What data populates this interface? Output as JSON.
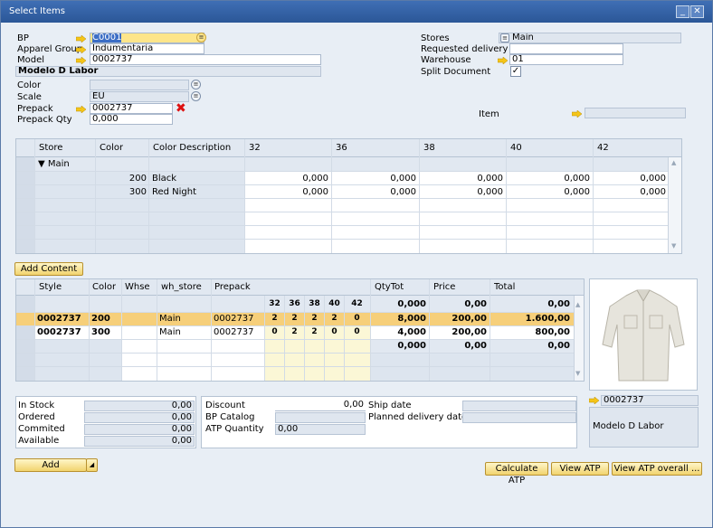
{
  "window": {
    "title": "Select Items"
  },
  "header": {
    "bp_label": "BP",
    "bp_value": "C0001",
    "apparel_label": "Apparel Group",
    "apparel_value": "Indumentaria",
    "model_label": "Model",
    "model_value": "0002737",
    "model_name": "Modelo D Labor",
    "color_label": "Color",
    "scale_label": "Scale",
    "scale_value": "EU",
    "prepack_label": "Prepack",
    "prepack_value": "0002737",
    "prepack_qty_label": "Prepack Qty",
    "prepack_qty_value": "0,000",
    "stores_label": "Stores",
    "stores_value": "Main",
    "reqdel_label": "Requested delivery d",
    "warehouse_label": "Warehouse",
    "warehouse_value": "01",
    "split_label": "Split Document",
    "split_checked": "✓",
    "item_label": "Item"
  },
  "matrix": {
    "headers": [
      "Store",
      "Color",
      "Color Description",
      "32",
      "36",
      "38",
      "40",
      "42"
    ],
    "group": "▼ Main",
    "rows": [
      {
        "color": "200",
        "desc": "Black",
        "v": [
          "0,000",
          "0,000",
          "0,000",
          "0,000",
          "0,000"
        ]
      },
      {
        "color": "300",
        "desc": "Red Night",
        "v": [
          "0,000",
          "0,000",
          "0,000",
          "0,000",
          "0,000"
        ]
      }
    ]
  },
  "add_content_label": "Add Content",
  "lines": {
    "headers": [
      "Style",
      "Color",
      "Whse",
      "wh_store",
      "Prepack",
      "QtyTot",
      "Price",
      "Total"
    ],
    "sizes": [
      "32",
      "36",
      "38",
      "40",
      "42"
    ],
    "top": {
      "qty": "0,000",
      "price": "0,00",
      "total": "0,00"
    },
    "rows": [
      {
        "style": "0002737",
        "color": "200",
        "wh": "Main",
        "prepack": "0002737",
        "s": [
          "2",
          "2",
          "2",
          "2",
          "0"
        ],
        "qty": "8,000",
        "price": "200,00",
        "total": "1.600,00"
      },
      {
        "style": "0002737",
        "color": "300",
        "wh": "Main",
        "prepack": "0002737",
        "s": [
          "0",
          "2",
          "2",
          "0",
          "0"
        ],
        "qty": "4,000",
        "price": "200,00",
        "total": "800,00"
      }
    ],
    "totals": {
      "qty": "0,000",
      "price": "0,00",
      "total": "0,00"
    }
  },
  "item_panel": {
    "code": "0002737",
    "name": "Modelo D Labor"
  },
  "stock": {
    "in_stock_label": "In Stock",
    "in_stock": "0,00",
    "ordered_label": "Ordered",
    "ordered": "0,00",
    "commited_label": "Commited",
    "commited": "0,00",
    "available_label": "Available",
    "available": "0,00"
  },
  "atp": {
    "discount_label": "Discount",
    "discount": "0,00",
    "bpcat_label": "BP Catalog",
    "atpqty_label": "ATP Quantity",
    "atpqty": "0,00",
    "ship_label": "Ship date",
    "planned_label": "Planned delivery date"
  },
  "buttons": {
    "add": "Add",
    "calc_atp": "Calculate ATP",
    "view_atp": "View ATP",
    "view_atp_overall": "View ATP overall ..."
  }
}
